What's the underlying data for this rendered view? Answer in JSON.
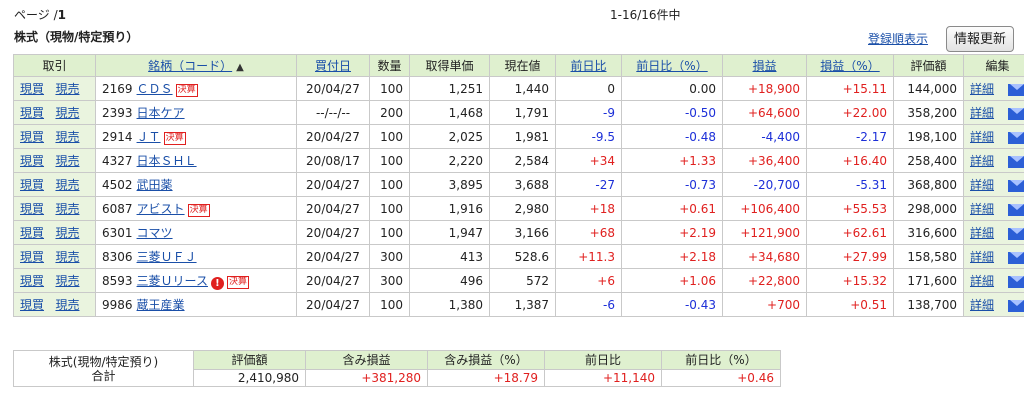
{
  "header": {
    "page_prefix": "ページ /",
    "page_num": "1",
    "count": "1-16/16件中",
    "section_title": "株式（現物/特定預り）",
    "order_link": "登録順表示",
    "refresh_button": "情報更新"
  },
  "columns": {
    "trade": "取引",
    "name": "銘柄（コード）",
    "sort_icon": "▲",
    "buy_date": "買付日",
    "qty": "数量",
    "cost": "取得単価",
    "price": "現在値",
    "change": "前日比",
    "change_pct": "前日比（%）",
    "pl": "損益",
    "pl_pct": "損益（%）",
    "value": "評価額",
    "edit": "編集"
  },
  "row_labels": {
    "buy": "現買",
    "sell": "現売",
    "detail": "詳細",
    "settle_badge": "決算",
    "alert_icon_text": "!"
  },
  "rows": [
    {
      "code": "2169",
      "name": "ＣＤＳ",
      "badge": true,
      "alert": false,
      "date": "20/04/27",
      "qty": "100",
      "cost": "1,251",
      "price": "1,440",
      "chg": "0",
      "chg_cls": "",
      "chgp": "0.00",
      "chgp_cls": "",
      "pl": "+18,900",
      "pl_cls": "pos",
      "plp": "+15.11",
      "plp_cls": "pos",
      "val": "144,000"
    },
    {
      "code": "2393",
      "name": "日本ケア",
      "badge": false,
      "alert": false,
      "date": "--/--/--",
      "qty": "200",
      "cost": "1,468",
      "price": "1,791",
      "chg": "-9",
      "chg_cls": "neg",
      "chgp": "-0.50",
      "chgp_cls": "neg",
      "pl": "+64,600",
      "pl_cls": "pos",
      "plp": "+22.00",
      "plp_cls": "pos",
      "val": "358,200"
    },
    {
      "code": "2914",
      "name": "ＪＴ",
      "badge": true,
      "alert": false,
      "date": "20/04/27",
      "qty": "100",
      "cost": "2,025",
      "price": "1,981",
      "chg": "-9.5",
      "chg_cls": "neg",
      "chgp": "-0.48",
      "chgp_cls": "neg",
      "pl": "-4,400",
      "pl_cls": "neg",
      "plp": "-2.17",
      "plp_cls": "neg",
      "val": "198,100"
    },
    {
      "code": "4327",
      "name": "日本ＳＨＬ",
      "badge": false,
      "alert": false,
      "date": "20/08/17",
      "qty": "100",
      "cost": "2,220",
      "price": "2,584",
      "chg": "+34",
      "chg_cls": "pos",
      "chgp": "+1.33",
      "chgp_cls": "pos",
      "pl": "+36,400",
      "pl_cls": "pos",
      "plp": "+16.40",
      "plp_cls": "pos",
      "val": "258,400"
    },
    {
      "code": "4502",
      "name": "武田薬",
      "badge": false,
      "alert": false,
      "date": "20/04/27",
      "qty": "100",
      "cost": "3,895",
      "price": "3,688",
      "chg": "-27",
      "chg_cls": "neg",
      "chgp": "-0.73",
      "chgp_cls": "neg",
      "pl": "-20,700",
      "pl_cls": "neg",
      "plp": "-5.31",
      "plp_cls": "neg",
      "val": "368,800"
    },
    {
      "code": "6087",
      "name": "アビスト",
      "badge": true,
      "alert": false,
      "date": "20/04/27",
      "qty": "100",
      "cost": "1,916",
      "price": "2,980",
      "chg": "+18",
      "chg_cls": "pos",
      "chgp": "+0.61",
      "chgp_cls": "pos",
      "pl": "+106,400",
      "pl_cls": "pos",
      "plp": "+55.53",
      "plp_cls": "pos",
      "val": "298,000"
    },
    {
      "code": "6301",
      "name": "コマツ",
      "badge": false,
      "alert": false,
      "date": "20/04/27",
      "qty": "100",
      "cost": "1,947",
      "price": "3,166",
      "chg": "+68",
      "chg_cls": "pos",
      "chgp": "+2.19",
      "chgp_cls": "pos",
      "pl": "+121,900",
      "pl_cls": "pos",
      "plp": "+62.61",
      "plp_cls": "pos",
      "val": "316,600"
    },
    {
      "code": "8306",
      "name": "三菱ＵＦＪ",
      "badge": false,
      "alert": false,
      "date": "20/04/27",
      "qty": "300",
      "cost": "413",
      "price": "528.6",
      "chg": "+11.3",
      "chg_cls": "pos",
      "chgp": "+2.18",
      "chgp_cls": "pos",
      "pl": "+34,680",
      "pl_cls": "pos",
      "plp": "+27.99",
      "plp_cls": "pos",
      "val": "158,580"
    },
    {
      "code": "8593",
      "name": "三菱Ｕリース",
      "badge": true,
      "alert": true,
      "date": "20/04/27",
      "qty": "300",
      "cost": "496",
      "price": "572",
      "chg": "+6",
      "chg_cls": "pos",
      "chgp": "+1.06",
      "chgp_cls": "pos",
      "pl": "+22,800",
      "pl_cls": "pos",
      "plp": "+15.32",
      "plp_cls": "pos",
      "val": "171,600"
    },
    {
      "code": "9986",
      "name": "蔵王産業",
      "badge": false,
      "alert": false,
      "date": "20/04/27",
      "qty": "100",
      "cost": "1,380",
      "price": "1,387",
      "chg": "-6",
      "chg_cls": "neg",
      "chgp": "-0.43",
      "chgp_cls": "neg",
      "pl": "+700",
      "pl_cls": "pos",
      "plp": "+0.51",
      "plp_cls": "pos",
      "val": "138,700"
    }
  ],
  "summary": {
    "label_line1": "株式(現物/特定預り)",
    "label_line2": "合計",
    "headers": [
      "評価額",
      "含み損益",
      "含み損益（%）",
      "前日比",
      "前日比（%）"
    ],
    "values": [
      "2,410,980",
      "+381,280",
      "+18.79",
      "+11,140",
      "+0.46"
    ],
    "classes": [
      "",
      "pos",
      "pos",
      "pos",
      "pos"
    ]
  },
  "colors": {
    "header_bg": "#dff0cf",
    "positive": "#e0201f",
    "negative": "#1c2fd8",
    "link": "#1a4fa8"
  }
}
